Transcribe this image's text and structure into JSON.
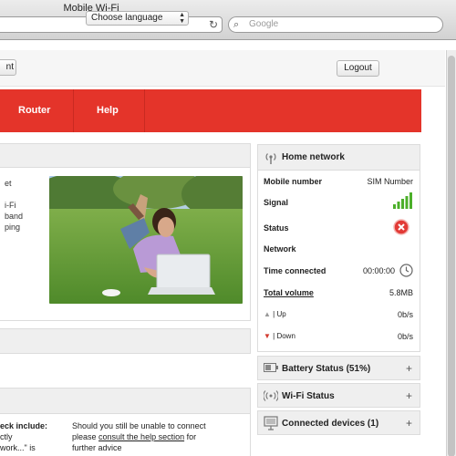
{
  "window": {
    "title": "Mobile Wi-Fi"
  },
  "browser": {
    "search_placeholder": "Google"
  },
  "toolbar": {
    "left_button": "nt",
    "language": "Choose language",
    "logout": "Logout"
  },
  "nav": {
    "items": [
      "Router",
      "Help"
    ]
  },
  "left": {
    "intro_lines": [
      "et",
      "",
      "i-Fi",
      "band",
      "ping",
      ""
    ],
    "check_lines": [
      "eck include:",
      "ctly",
      "work...\" is"
    ],
    "help_line1": "Should you still be unable to connect",
    "help_pre": "please ",
    "help_link": "consult the help section",
    "help_post": " for",
    "help_line3": "further advice"
  },
  "home": {
    "title": "Home network",
    "mobile_number_label": "Mobile number",
    "mobile_number_value": "SIM Number",
    "signal_label": "Signal",
    "signal_bars": 5,
    "status_label": "Status",
    "network_label": "Network",
    "time_label": "Time connected",
    "time_value": "00:00:00",
    "volume_label": "Total volume",
    "volume_value": "5.8MB",
    "up_label": "| Up",
    "up_value": "0b/s",
    "down_label": "| Down",
    "down_value": "0b/s"
  },
  "accordions": {
    "battery": "Battery Status (51%)",
    "wifi": "Wi-Fi Status",
    "devices": "Connected devices (1)"
  },
  "colors": {
    "brand_red": "#e4342a",
    "signal_green": "#4caf2a"
  }
}
